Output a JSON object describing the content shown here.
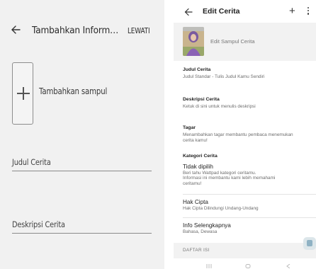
{
  "left_screen": {
    "title": "Tambahkan Informasi Ceri...",
    "skip_label": "LEWATI",
    "cover_label": "Tambahkan sampul",
    "story_title_placeholder": "Judul Cerita",
    "story_description_placeholder": "Deskripsi Cerita"
  },
  "right_screen": {
    "title": "Edit Cerita",
    "edit_cover_label": "Edit Sampul Cerita",
    "sections": {
      "title": {
        "heading": "Judul Cerita",
        "value": "Judul Standar - Tulis Judul Kamu Sendiri"
      },
      "description": {
        "heading": "Deskripsi Cerita",
        "value": "Ketuk di sini untuk menulis deskripsi"
      },
      "tags": {
        "heading": "Tagar",
        "line1": "Menambahkan tagar membantu pembaca menemukan",
        "line2": "cerita kamu!"
      },
      "category": {
        "heading": "Kategori Cerita",
        "value": "Tidak dipilih",
        "line1": "Beri tahu Wattpad kategori ceritamu.",
        "line2": "Informasi ini membantu kami lebih memahami",
        "line3": "ceritamu!"
      },
      "copyright": {
        "title": "Hak Cipta",
        "value": "Hak Cipta Dilindungi Undang-Undang"
      },
      "more_info": {
        "title": "Info Selengkapnya",
        "value": "Bahasa, Dewasa"
      }
    },
    "toc_label": "DAFTAR ISI"
  },
  "icons": {
    "back": "arrow-left-icon",
    "add": "plus-icon",
    "more": "more-vertical-icon",
    "add_cover": "plus-icon",
    "fab": "chat-icon"
  },
  "colors": {
    "left_background": "#f1f1f1",
    "right_background": "#ffffff",
    "divider": "#e3e3e3"
  }
}
